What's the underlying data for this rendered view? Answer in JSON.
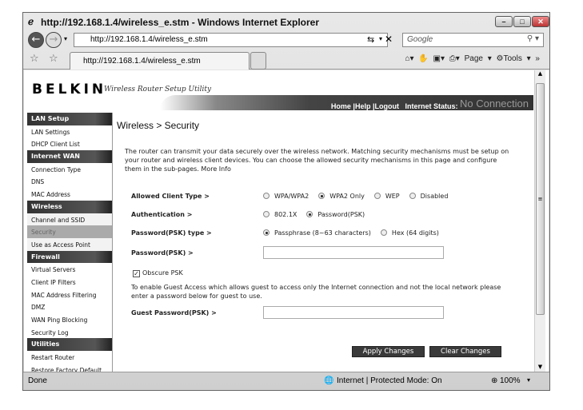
{
  "window": {
    "title": "http://192.168.1.4/wireless_e.stm - Windows Internet Explorer"
  },
  "nav": {
    "address": "http://192.168.1.4/wireless_e.stm",
    "search_placeholder": "Google"
  },
  "tab": {
    "label": "http://192.168.1.4/wireless_e.stm"
  },
  "toolbar": {
    "page": "Page ▾",
    "tools": "Tools ▾"
  },
  "header": {
    "logo": "BELKIN",
    "tagline": "Wireless Router Setup Utility",
    "links": "Home |Help |Logout",
    "status_label": "Internet Status:",
    "status_value": "No Connection"
  },
  "sidebar": [
    {
      "type": "header",
      "label": "LAN Setup"
    },
    {
      "type": "item",
      "label": "LAN Settings"
    },
    {
      "type": "item",
      "label": "DHCP Client List"
    },
    {
      "type": "header",
      "label": "Internet WAN"
    },
    {
      "type": "item",
      "label": "Connection Type"
    },
    {
      "type": "item",
      "label": "DNS"
    },
    {
      "type": "item",
      "label": "MAC Address"
    },
    {
      "type": "header",
      "label": "Wireless"
    },
    {
      "type": "item",
      "label": "Channel and SSID",
      "hl": true
    },
    {
      "type": "item",
      "label": "Security",
      "selected": true
    },
    {
      "type": "item",
      "label": "Use as Access Point",
      "hl": true
    },
    {
      "type": "header",
      "label": "Firewall"
    },
    {
      "type": "item",
      "label": "Virtual Servers"
    },
    {
      "type": "item",
      "label": "Client IP Filters"
    },
    {
      "type": "item",
      "label": "MAC Address Filtering"
    },
    {
      "type": "item",
      "label": "DMZ"
    },
    {
      "type": "item",
      "label": "WAN Ping Blocking"
    },
    {
      "type": "item",
      "label": "Security Log"
    },
    {
      "type": "header",
      "label": "Utilities"
    },
    {
      "type": "item",
      "label": "Restart Router"
    },
    {
      "type": "item",
      "label": "Restore Factory Default"
    }
  ],
  "main": {
    "title": "Wireless > Security",
    "intro": "The router can transmit your data securely over the wireless network. Matching security mechanisms must be setup on your router and wireless client devices. You can choose the allowed security mechanisms in this page and configure them in the sub-pages.",
    "more_info": "More Info",
    "allowed_label": "Allowed Client Type >",
    "allowed_options": [
      "WPA/WPA2",
      "WPA2 Only",
      "WEP",
      "Disabled"
    ],
    "allowed_selected": 1,
    "auth_label": "Authentication >",
    "auth_options": [
      "802.1X",
      "Password(PSK)"
    ],
    "auth_selected": 1,
    "psktype_label": "Password(PSK) type >",
    "psktype_options": [
      "Passphrase (8~63 characters)",
      "Hex (64 digits)"
    ],
    "psktype_selected": 0,
    "psk_label": "Password(PSK) >",
    "psk_value": "",
    "obscure_label": "Obscure PSK",
    "obscure_checked": true,
    "guest_text": "To enable Guest Access which allows guest to access only the Internet connection and not the local network please enter a password below for guest to use.",
    "guest_label": "Guest Password(PSK) >",
    "guest_value": "",
    "apply": "Apply Changes",
    "clear": "Clear Changes"
  },
  "statusbar": {
    "text": "Done",
    "zone": "Internet | Protected Mode: On",
    "zoom": "100%"
  }
}
